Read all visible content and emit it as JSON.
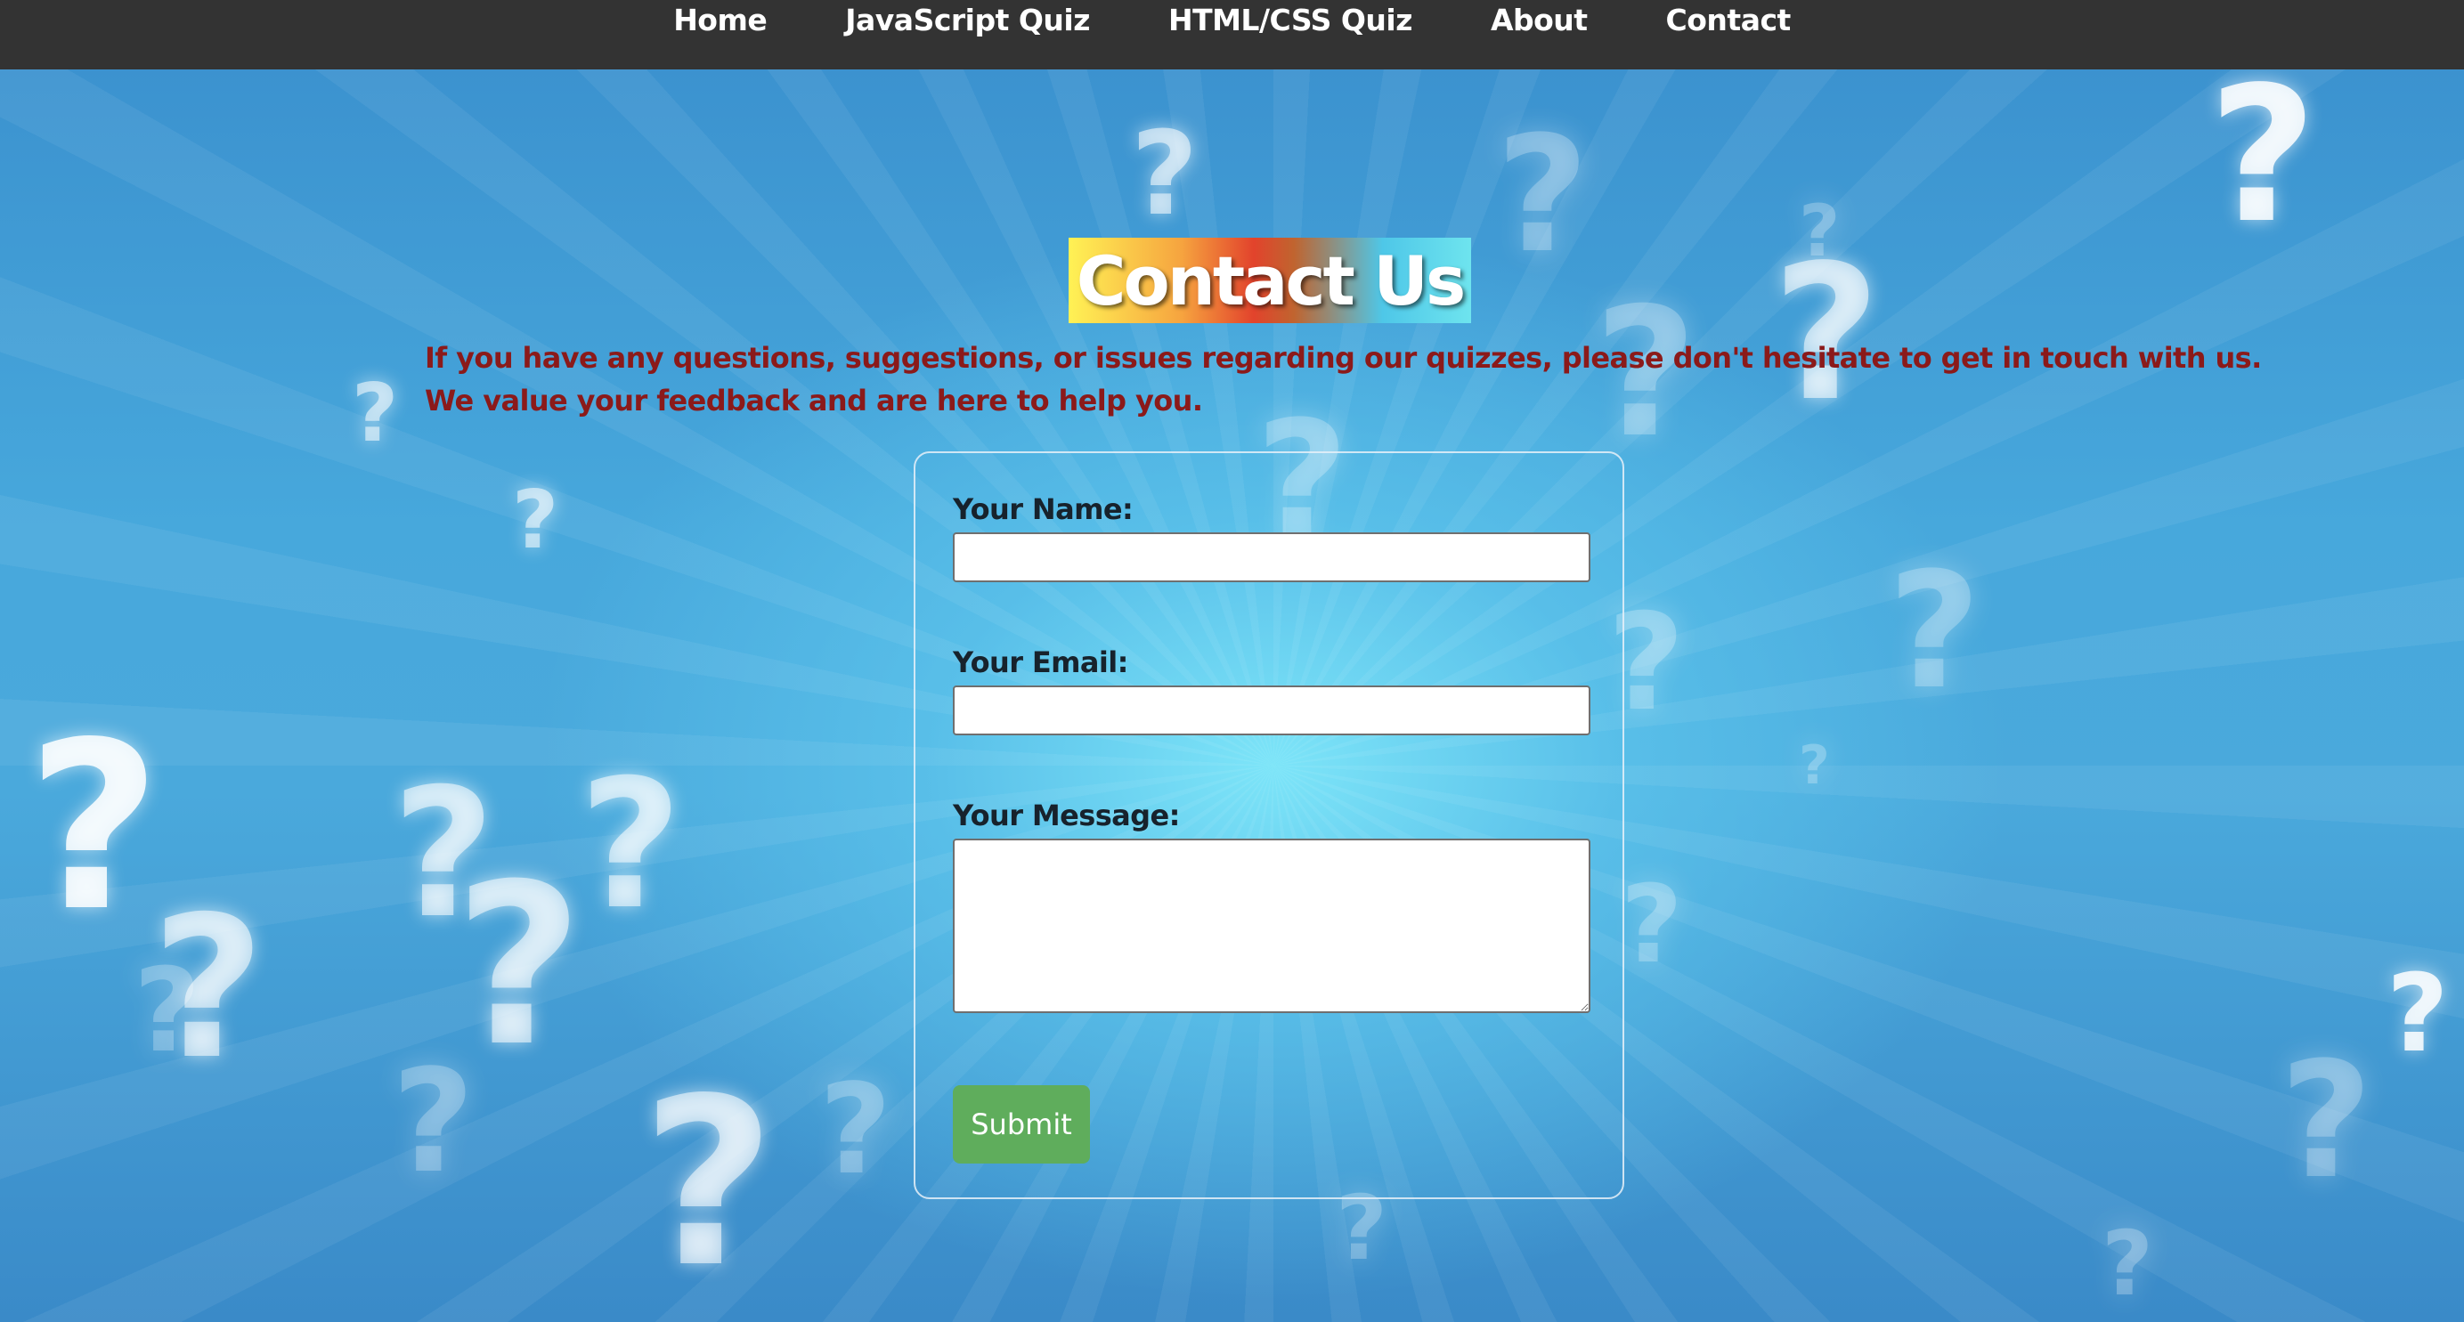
{
  "nav": {
    "items": [
      {
        "label": "Home"
      },
      {
        "label": "JavaScript Quiz"
      },
      {
        "label": "HTML/CSS Quiz"
      },
      {
        "label": "About"
      },
      {
        "label": "Contact"
      }
    ]
  },
  "header": {
    "title": "Contact Us"
  },
  "intro": {
    "line1": "If you have any questions, suggestions, or issues regarding our quizzes, please don't hesitate to get in touch with us.",
    "line2": "We value your feedback and are here to help you."
  },
  "form": {
    "name_label": "Your Name:",
    "name_value": "",
    "email_label": "Your Email:",
    "email_value": "",
    "message_label": "Your Message:",
    "message_value": "",
    "submit_label": "Submit"
  },
  "colors": {
    "navbar_bg": "#333333",
    "intro_text": "#8b1a1a",
    "submit_bg": "#5fad5c"
  },
  "background": {
    "icon": "question-mark-icon"
  }
}
